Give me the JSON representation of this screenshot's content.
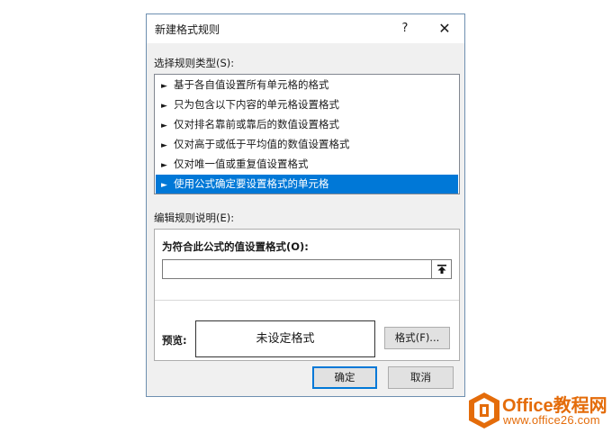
{
  "dialog": {
    "title": "新建格式规则",
    "help_label": "?",
    "close_label": "✕"
  },
  "rule_types": {
    "label": "选择规则类型(S):",
    "arrow": "►",
    "items": [
      {
        "label": "基于各自值设置所有单元格的格式",
        "selected": false
      },
      {
        "label": "只为包含以下内容的单元格设置格式",
        "selected": false
      },
      {
        "label": "仅对排名靠前或靠后的数值设置格式",
        "selected": false
      },
      {
        "label": "仅对高于或低于平均值的数值设置格式",
        "selected": false
      },
      {
        "label": "仅对唯一值或重复值设置格式",
        "selected": false
      },
      {
        "label": "使用公式确定要设置格式的单元格",
        "selected": true
      }
    ]
  },
  "rule_description": {
    "label": "编辑规则说明(E):",
    "formula_label": "为符合此公式的值设置格式(O):",
    "formula_value": "",
    "preview_label": "预览:",
    "preview_text": "未设定格式",
    "format_button": "格式(F)..."
  },
  "footer": {
    "ok_label": "确定",
    "cancel_label": "取消"
  },
  "watermark": {
    "brand": "Office教程网",
    "url": "www.office26.com"
  },
  "colors": {
    "accent": "#0078d7",
    "logo": "#e46c0a"
  }
}
